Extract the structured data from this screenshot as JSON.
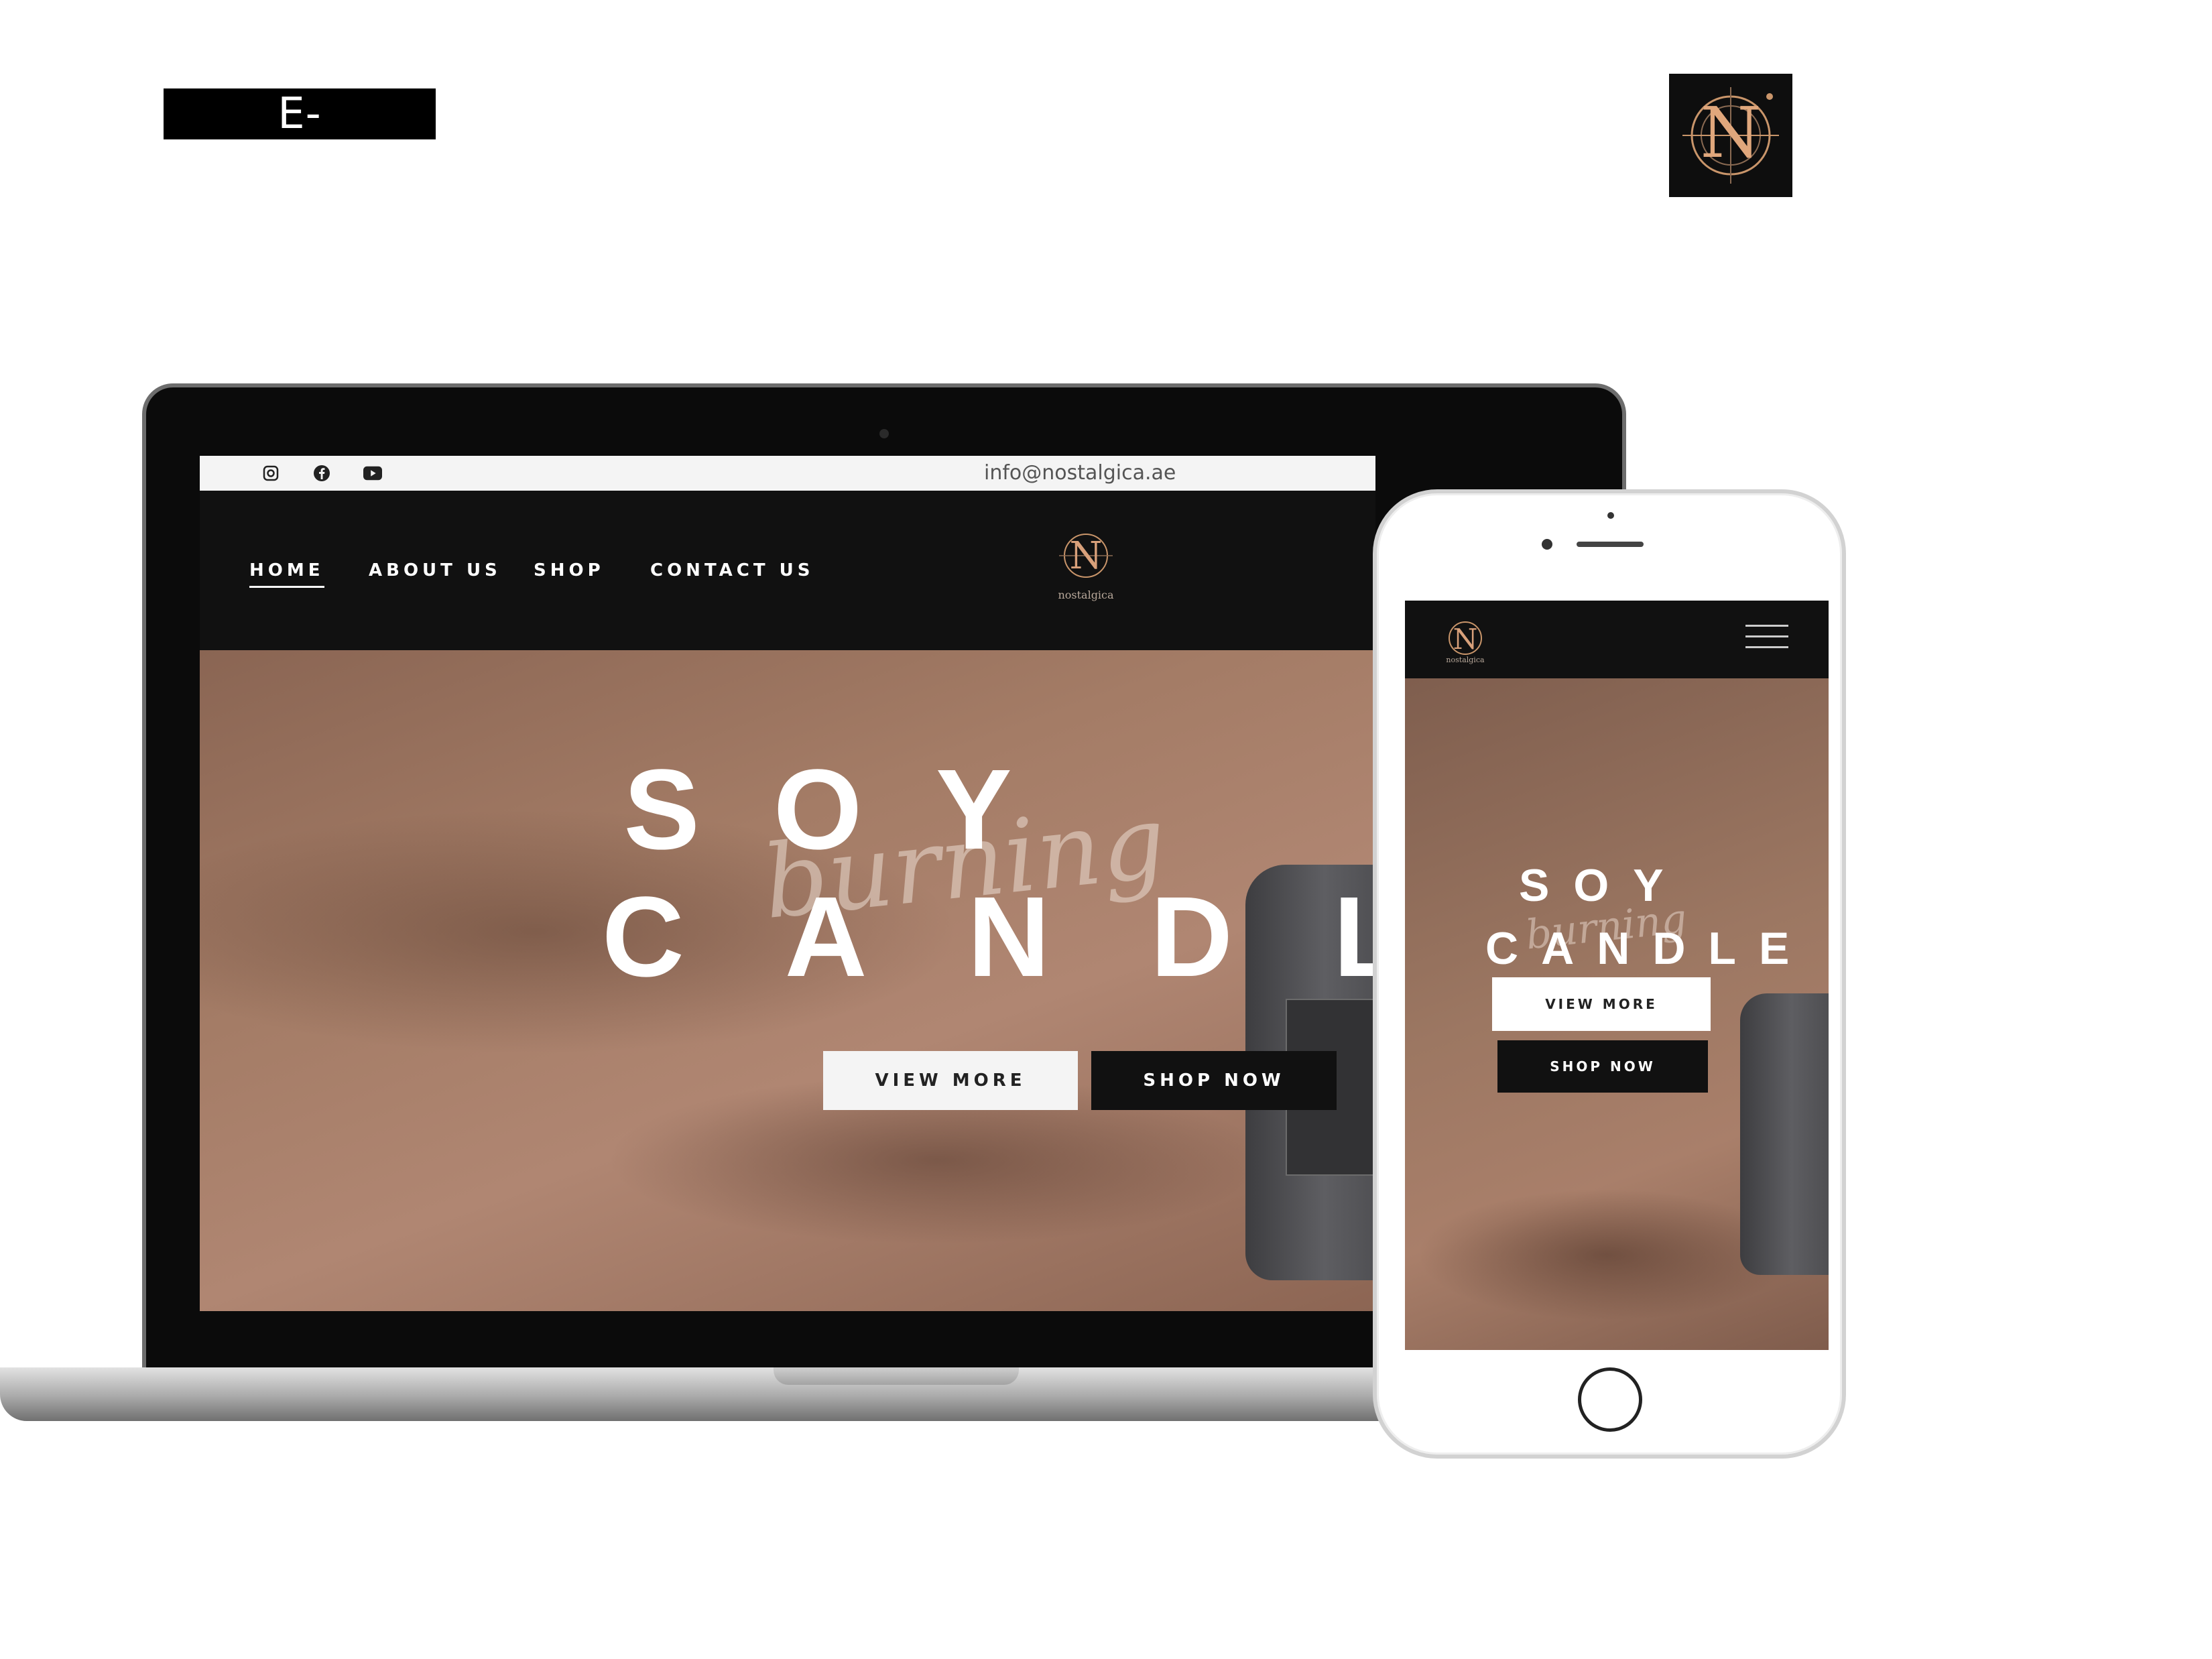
{
  "presentation": {
    "category_label": "E-commerce",
    "brand_logo_letter": "N"
  },
  "desktop": {
    "topbar": {
      "social_icons": [
        "instagram-icon",
        "facebook-icon",
        "youtube-icon"
      ],
      "email": "info@nostalgica.ae"
    },
    "nav": {
      "items": [
        {
          "label": "HOME",
          "active": true
        },
        {
          "label": "ABOUT US",
          "active": false
        },
        {
          "label": "SHOP",
          "active": false
        },
        {
          "label": "CONTACT US",
          "active": false
        }
      ],
      "logo_letter": "N",
      "logo_text": "nostalgica"
    },
    "hero": {
      "line1": "SOY",
      "line2": "CANDL",
      "script": "burning",
      "view_more": "VIEW MORE",
      "shop_now": "SHOP NOW"
    }
  },
  "mobile": {
    "logo_letter": "N",
    "logo_text": "nostalgica",
    "menu_icon": "hamburger-menu-icon",
    "hero": {
      "line1": "SOY",
      "line2": "CANDLE",
      "script": "burning",
      "view_more": "VIEW MORE",
      "shop_now": "SHOP NOW"
    }
  },
  "colors": {
    "accent_gold": "#c9956a",
    "dark": "#111111",
    "hero_tan": "#a47c66"
  }
}
